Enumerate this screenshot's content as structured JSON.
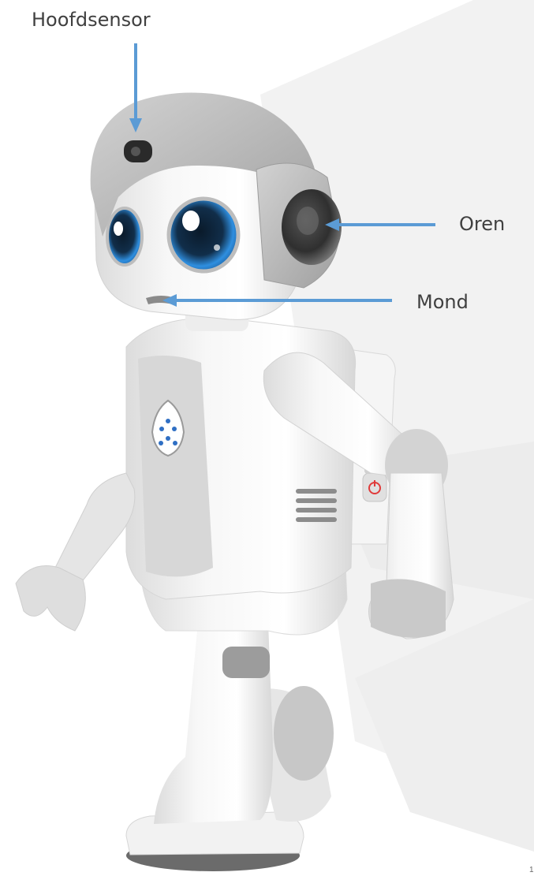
{
  "labels": {
    "head_sensor": "Hoofdsensor",
    "ears": "Oren",
    "mouth": "Mond"
  },
  "page_number": "1",
  "colors": {
    "label_text": "#404040",
    "arrow": "#5b9bd5",
    "robot_white": "#f4f4f4",
    "robot_gray": "#bdbdbd",
    "eye_blue": "#2f8fe0",
    "power_red": "#e03a3a"
  },
  "icons": [
    "head-sensor-icon",
    "robot-logo-icon",
    "power-button-icon"
  ]
}
